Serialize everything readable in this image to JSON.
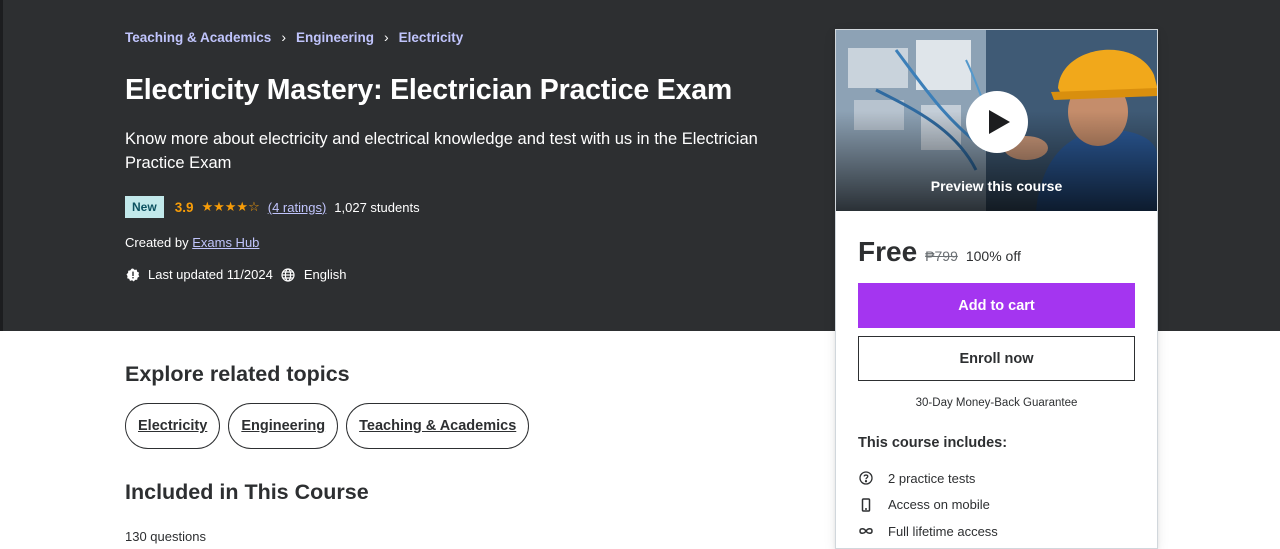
{
  "breadcrumb": [
    {
      "label": "Teaching & Academics"
    },
    {
      "label": "Engineering"
    },
    {
      "label": "Electricity"
    }
  ],
  "course": {
    "title": "Electricity Mastery: Electrician Practice Exam",
    "subtitle": "Know more about electricity and electrical knowledge and test with us in the Electrician Practice Exam",
    "badge": "New",
    "rating": "3.9",
    "stars": 3.9,
    "ratings_text": "(4 ratings)",
    "students": "1,027 students",
    "created_prefix": "Created by",
    "author": "Exams Hub",
    "last_updated": "Last updated 11/2024",
    "language": "English"
  },
  "card": {
    "preview_label": "Preview this course",
    "price": "Free",
    "original_price": "₱799",
    "discount": "100% off",
    "add_to_cart": "Add to cart",
    "enroll_now": "Enroll now",
    "guarantee": "30-Day Money-Back Guarantee",
    "includes_title": "This course includes:",
    "includes": [
      {
        "icon": "question-circle-icon",
        "label": "2 practice tests"
      },
      {
        "icon": "mobile-icon",
        "label": "Access on mobile"
      },
      {
        "icon": "infinity-icon",
        "label": "Full lifetime access"
      }
    ]
  },
  "related": {
    "title": "Explore related topics",
    "topics": [
      "Electricity",
      "Engineering",
      "Teaching & Academics"
    ]
  },
  "included": {
    "title": "Included in This Course",
    "questions": "130 questions"
  },
  "colors": {
    "hero_bg": "#2d2f31",
    "link": "#c0c4fc",
    "star": "#f69c08",
    "cart": "#a435f0",
    "badge_bg": "#c2e9eb"
  }
}
